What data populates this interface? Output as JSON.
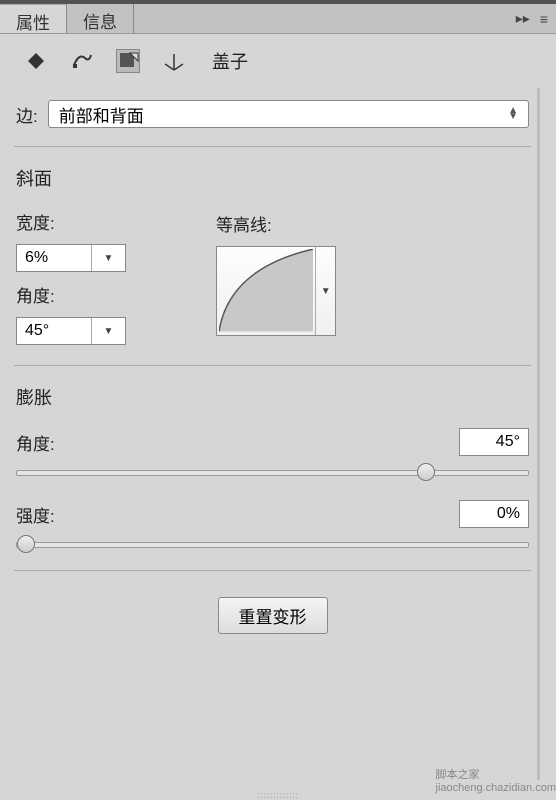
{
  "tabs": {
    "properties": "属性",
    "info": "信息"
  },
  "toolbar": {
    "label": "盖子"
  },
  "edge": {
    "label": "边:",
    "selected": "前部和背面"
  },
  "bevel": {
    "title": "斜面",
    "width_label": "宽度:",
    "width_value": "6%",
    "angle_label": "角度:",
    "angle_value": "45°",
    "contour_label": "等高线:"
  },
  "inflate": {
    "title": "膨胀",
    "angle_label": "角度:",
    "angle_value": "45°",
    "angle_pos_pct": 80,
    "strength_label": "强度:",
    "strength_value": "0%",
    "strength_pos_pct": 2
  },
  "reset": {
    "label": "重置变形"
  },
  "watermark": {
    "line1": "脚本之家",
    "line2": "jiaocheng.chazidian.com"
  }
}
